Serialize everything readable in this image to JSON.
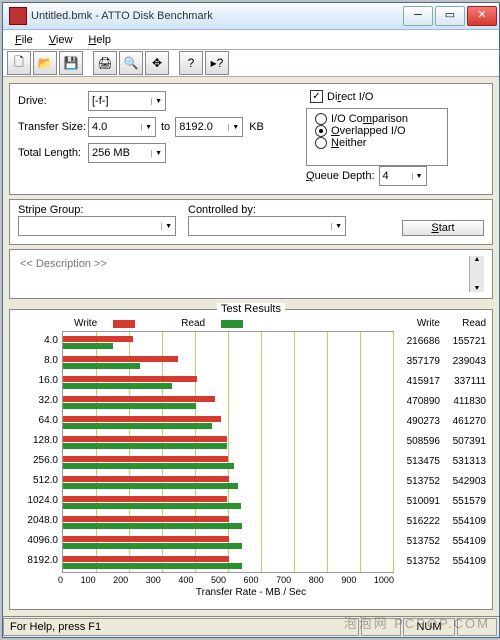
{
  "window": {
    "title": "Untitled.bmk - ATTO Disk Benchmark"
  },
  "menu": {
    "file": "File",
    "view": "View",
    "help": "Help"
  },
  "panel": {
    "drive_label": "Drive:",
    "drive_value": "[-f-]",
    "tsize_label": "Transfer Size:",
    "tsize_from": "4.0",
    "to_label": "to",
    "tsize_to": "8192.0",
    "kb": "KB",
    "tlen_label": "Total Length:",
    "tlen_value": "256 MB",
    "direct_io": "Direct I/O",
    "io_comparison": "I/O Comparison",
    "overlapped_io": "Overlapped I/O",
    "neither": "Neither",
    "queue_depth_label": "Queue Depth:",
    "queue_depth_value": "4",
    "stripe_label": "Stripe Group:",
    "controlled_label": "Controlled by:",
    "start": "Start",
    "description": "<< Description >>"
  },
  "test": {
    "title": "Test Results",
    "write": "Write",
    "read": "Read",
    "xlabel": "Transfer Rate - MB / Sec"
  },
  "chart_data": {
    "type": "bar",
    "xlabel": "Transfer Rate - MB / Sec",
    "xlim": [
      0,
      1000
    ],
    "xticks": [
      0,
      100,
      200,
      300,
      400,
      500,
      600,
      700,
      800,
      900,
      1000
    ],
    "categories": [
      "4.0",
      "8.0",
      "16.0",
      "32.0",
      "64.0",
      "128.0",
      "256.0",
      "512.0",
      "1024.0",
      "2048.0",
      "4096.0",
      "8192.0"
    ],
    "series": [
      {
        "name": "Write",
        "color": "#d43a2f",
        "values_kb_s": [
          216686,
          357179,
          415917,
          470890,
          490273,
          508596,
          513475,
          513752,
          510091,
          516222,
          513752,
          513752
        ]
      },
      {
        "name": "Read",
        "color": "#2a9030",
        "values_kb_s": [
          155721,
          239043,
          337111,
          411830,
          461270,
          507391,
          531313,
          542903,
          551579,
          554109,
          554109,
          554109
        ]
      }
    ]
  },
  "status": {
    "help": "For Help, press F1",
    "num": "NUM"
  },
  "watermark": "泡泡网 PCPOP.COM"
}
